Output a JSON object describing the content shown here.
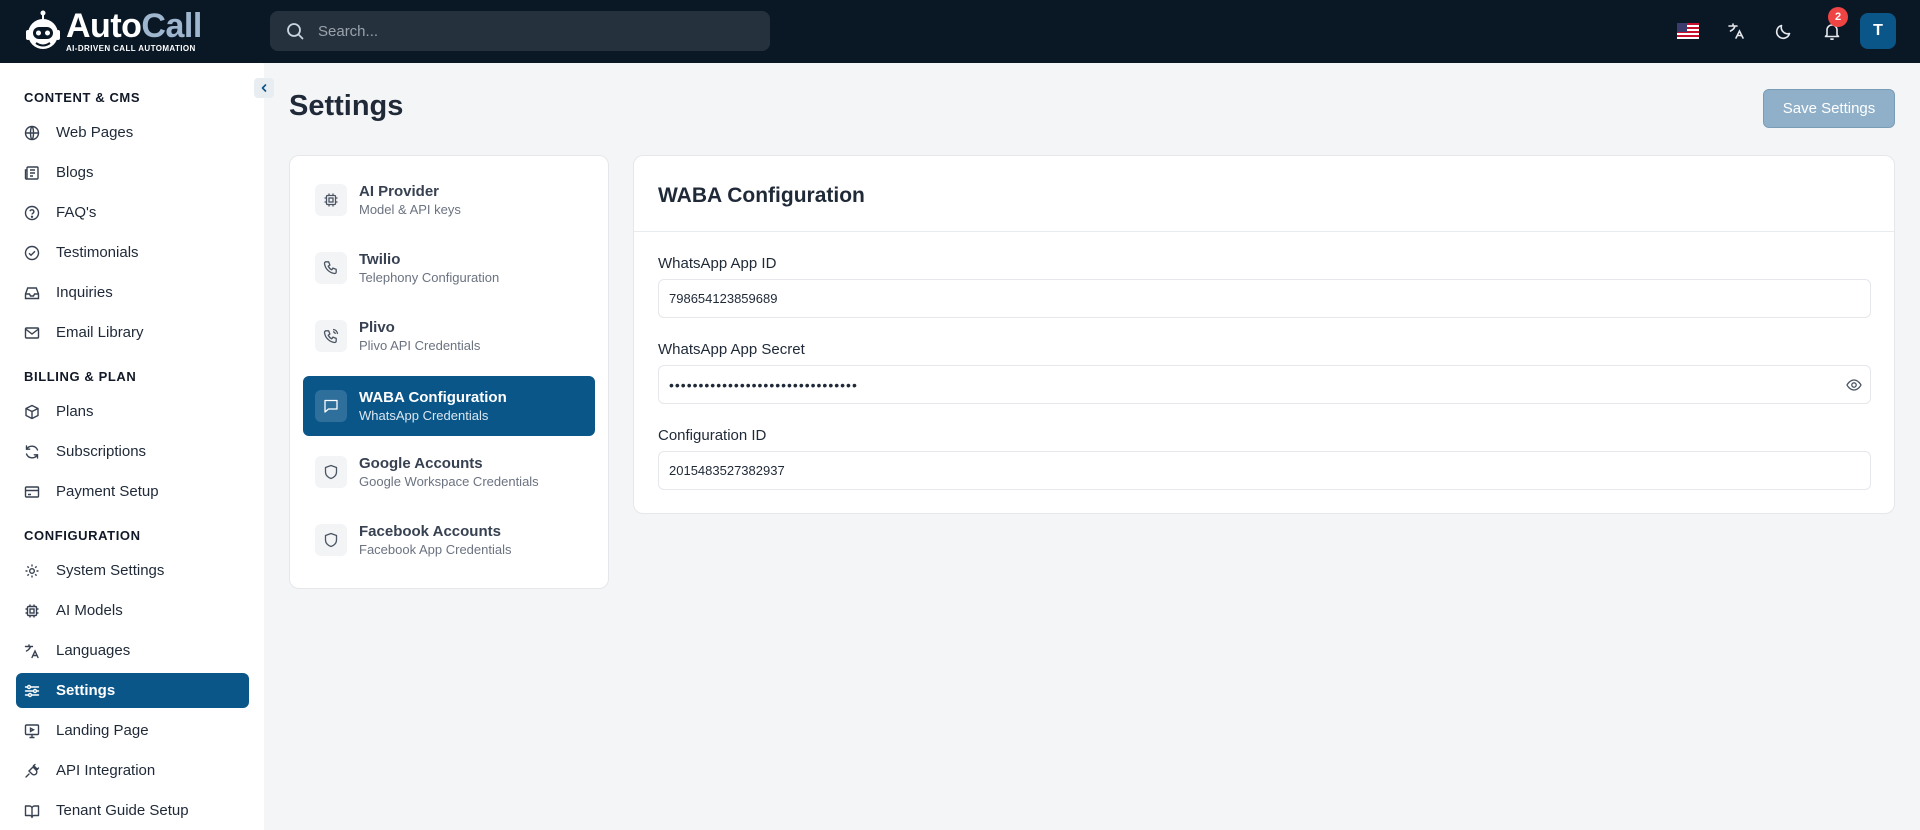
{
  "app": {
    "name_part1": "Auto",
    "name_part2": "Call",
    "tagline": "AI-DRIVEN CALL AUTOMATION"
  },
  "header": {
    "search_placeholder": "Search...",
    "notification_count": "2",
    "avatar_initial": "T",
    "icons": [
      "us-flag-icon",
      "translate-icon",
      "moon-icon",
      "bell-icon"
    ]
  },
  "sidebar": {
    "sections": [
      {
        "title": "CONTENT & CMS",
        "items": [
          {
            "label": "Web Pages",
            "icon": "globe-icon"
          },
          {
            "label": "Blogs",
            "icon": "newspaper-icon"
          },
          {
            "label": "FAQ's",
            "icon": "help-circle-icon"
          },
          {
            "label": "Testimonials",
            "icon": "check-circle-icon"
          },
          {
            "label": "Inquiries",
            "icon": "inbox-icon"
          },
          {
            "label": "Email Library",
            "icon": "mail-icon"
          }
        ]
      },
      {
        "title": "BILLING & PLAN",
        "items": [
          {
            "label": "Plans",
            "icon": "package-icon"
          },
          {
            "label": "Subscriptions",
            "icon": "refresh-icon"
          },
          {
            "label": "Payment Setup",
            "icon": "credit-card-icon"
          }
        ]
      },
      {
        "title": "CONFIGURATION",
        "items": [
          {
            "label": "System Settings",
            "icon": "sliders-icon"
          },
          {
            "label": "AI Models",
            "icon": "cpu-icon"
          },
          {
            "label": "Languages",
            "icon": "languages-icon"
          },
          {
            "label": "Settings",
            "icon": "settings-sliders-icon",
            "active": true
          },
          {
            "label": "Landing Page",
            "icon": "monitor-icon"
          },
          {
            "label": "API Integration",
            "icon": "plug-icon"
          },
          {
            "label": "Tenant Guide Setup",
            "icon": "book-icon"
          }
        ]
      }
    ]
  },
  "main": {
    "title": "Settings",
    "save_label": "Save Settings",
    "settings_nav": [
      {
        "title": "AI Provider",
        "subtitle": "Model & API keys",
        "icon": "cpu-icon"
      },
      {
        "title": "Twilio",
        "subtitle": "Telephony Configuration",
        "icon": "phone-icon"
      },
      {
        "title": "Plivo",
        "subtitle": "Plivo API Credentials",
        "icon": "phone-call-icon"
      },
      {
        "title": "WABA Configuration",
        "subtitle": "WhatsApp Credentials",
        "icon": "message-square-icon",
        "active": true
      },
      {
        "title": "Google Accounts",
        "subtitle": "Google Workspace Credentials",
        "icon": "shield-icon"
      },
      {
        "title": "Facebook Accounts",
        "subtitle": "Facebook App Credentials",
        "icon": "shield-icon"
      }
    ],
    "card": {
      "title": "WABA Configuration",
      "fields": [
        {
          "label": "WhatsApp App ID",
          "value": "798654123859689"
        },
        {
          "label": "WhatsApp App Secret",
          "value": "••••••••••••••••••••••••••••••••"
        },
        {
          "label": "Configuration ID",
          "value": "2015483527382937"
        }
      ]
    }
  },
  "colors": {
    "topbar": "#0a1826",
    "accent": "#0a5689",
    "save_button": "#8fb0c8",
    "badge": "#ef4444"
  }
}
